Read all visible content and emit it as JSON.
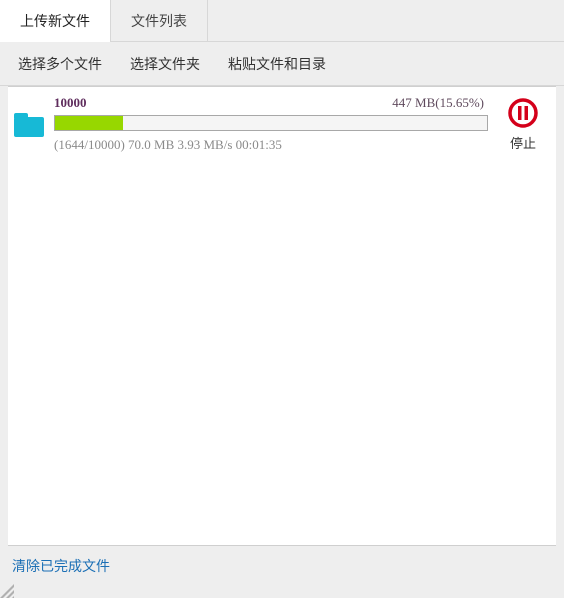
{
  "tabs": {
    "upload_new": "上传新文件",
    "file_list": "文件列表"
  },
  "toolbar": {
    "select_files": "选择多个文件",
    "select_folder": "选择文件夹",
    "paste_files": "粘贴文件和目录"
  },
  "upload": {
    "name": "10000",
    "size_text": "447 MB(15.65%)",
    "progress_percent": 15.65,
    "stats": "(1644/10000) 70.0 MB 3.93 MB/s 00:01:35",
    "stop_label": "停止"
  },
  "footer": {
    "clear_completed": "清除已完成文件"
  }
}
